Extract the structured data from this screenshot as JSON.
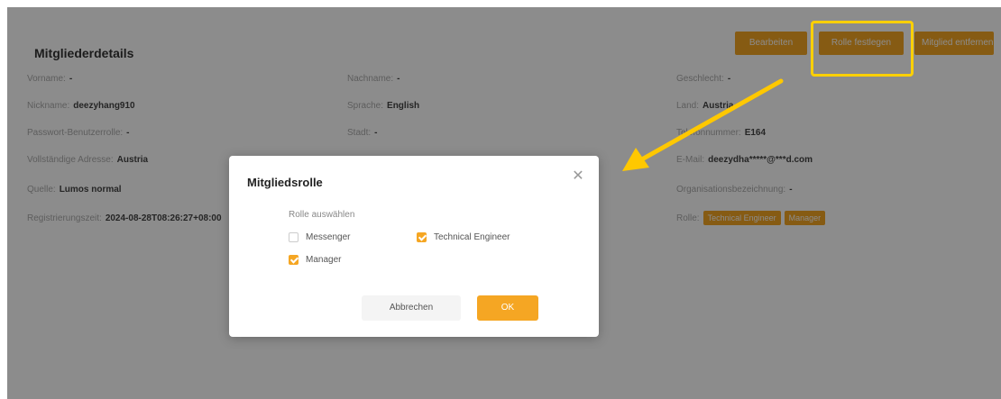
{
  "panel": {
    "title": "Mitgliederdetails",
    "buttons": [
      {
        "label": "Bearbeiten"
      },
      {
        "label": "Rolle festlegen"
      },
      {
        "label": "Mitglied entfernen"
      }
    ]
  },
  "fields": {
    "col1": [
      {
        "label": "Vorname:",
        "value": "-"
      },
      {
        "label": "Nickname:",
        "value": "deezyhang910"
      },
      {
        "label": "Passwort-Benutzerrolle:",
        "value": "-"
      },
      {
        "label": "Vollständige Adresse:",
        "value": "Austria"
      },
      {
        "label": "Quelle:",
        "value": "Lumos normal"
      },
      {
        "label": "Registrierungszeit:",
        "value": "2024-08-28T08:26:27+08:00"
      }
    ],
    "col2": [
      {
        "label": "Nachname:",
        "value": "-"
      },
      {
        "label": "Sprache:",
        "value": "English"
      },
      {
        "label": "Stadt:",
        "value": "-"
      }
    ],
    "col3": [
      {
        "label": "Geschlecht:",
        "value": "-"
      },
      {
        "label": "Land:",
        "value": "Austria"
      },
      {
        "label": "Telefonnummer:",
        "value": "E164"
      },
      {
        "label": "E-Mail:",
        "value": "deezydha*****@***d.com"
      },
      {
        "label": "Organisationsbezeichnung:",
        "value": "-"
      },
      {
        "label": "Rolle:",
        "tags": [
          "Technical Engineer",
          "Manager"
        ]
      }
    ]
  },
  "modal": {
    "title": "Mitgliedsrolle",
    "close_icon": "close-icon",
    "role_label": "Rolle auswählen",
    "options": [
      {
        "label": "Messenger",
        "checked": false
      },
      {
        "label": "Technical Engineer",
        "checked": true
      },
      {
        "label": "Manager",
        "checked": true
      }
    ],
    "cancel_label": "Abbrechen",
    "ok_label": "OK"
  },
  "colors": {
    "accent": "#f5a623",
    "highlight": "#ffd000"
  }
}
